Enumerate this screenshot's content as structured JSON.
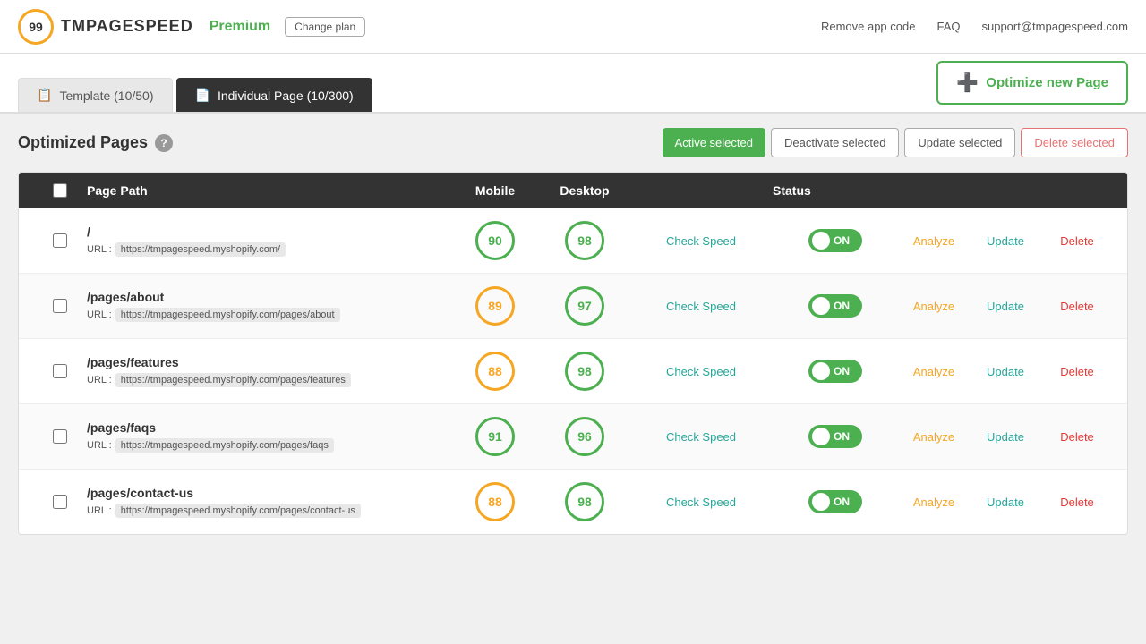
{
  "header": {
    "logo_number": "99",
    "logo_text": "TMPAGESPEED",
    "premium_label": "Premium",
    "change_plan_label": "Change plan",
    "nav": [
      {
        "label": "Remove app code",
        "name": "remove-app-code"
      },
      {
        "label": "FAQ",
        "name": "faq"
      },
      {
        "label": "support@tmpagespeed.com",
        "name": "support-email"
      }
    ]
  },
  "tabs": [
    {
      "label": "Template (10/50)",
      "icon": "📋",
      "active": false,
      "name": "template-tab"
    },
    {
      "label": "Individual Page (10/300)",
      "icon": "📄",
      "active": true,
      "name": "individual-page-tab"
    }
  ],
  "optimize_button": {
    "label": "Optimize new Page",
    "icon": "➕"
  },
  "section": {
    "title": "Optimized Pages",
    "help_icon": "?",
    "buttons": {
      "active_selected": "Active selected",
      "deactivate_selected": "Deactivate selected",
      "update_selected": "Update selected",
      "delete_selected": "Delete selected"
    }
  },
  "table": {
    "headers": {
      "checkbox": "",
      "page_path": "Page Path",
      "mobile": "Mobile",
      "desktop": "Desktop",
      "check_speed": "",
      "status": "Status",
      "analyze": "",
      "update": "",
      "delete": ""
    },
    "rows": [
      {
        "id": 1,
        "path": "/",
        "url": "https://tmpagespeed.myshopify.com/",
        "mobile_score": 90,
        "mobile_color": "green",
        "desktop_score": 98,
        "desktop_color": "green",
        "status": "ON",
        "check_speed_label": "Check Speed",
        "analyze_label": "Analyze",
        "update_label": "Update",
        "delete_label": "Delete"
      },
      {
        "id": 2,
        "path": "/pages/about",
        "url": "https://tmpagespeed.myshopify.com/pages/about",
        "mobile_score": 89,
        "mobile_color": "orange",
        "desktop_score": 97,
        "desktop_color": "green",
        "status": "ON",
        "check_speed_label": "Check Speed",
        "analyze_label": "Analyze",
        "update_label": "Update",
        "delete_label": "Delete"
      },
      {
        "id": 3,
        "path": "/pages/features",
        "url": "https://tmpagespeed.myshopify.com/pages/features",
        "mobile_score": 88,
        "mobile_color": "orange",
        "desktop_score": 98,
        "desktop_color": "green",
        "status": "ON",
        "check_speed_label": "Check Speed",
        "analyze_label": "Analyze",
        "update_label": "Update",
        "delete_label": "Delete"
      },
      {
        "id": 4,
        "path": "/pages/faqs",
        "url": "https://tmpagespeed.myshopify.com/pages/faqs",
        "mobile_score": 91,
        "mobile_color": "green",
        "desktop_score": 96,
        "desktop_color": "green",
        "status": "ON",
        "check_speed_label": "Check Speed",
        "analyze_label": "Analyze",
        "update_label": "Update",
        "delete_label": "Delete"
      },
      {
        "id": 5,
        "path": "/pages/contact-us",
        "url": "https://tmpagespeed.myshopify.com/pages/contact-us",
        "mobile_score": 88,
        "mobile_color": "orange",
        "desktop_score": 98,
        "desktop_color": "green",
        "status": "ON",
        "check_speed_label": "Check Speed",
        "analyze_label": "Analyze",
        "update_label": "Update",
        "delete_label": "Delete"
      }
    ]
  },
  "colors": {
    "green": "#4caf50",
    "orange": "#f5a623",
    "teal": "#26a69a",
    "red": "#e53935",
    "dark_header": "#333333"
  }
}
